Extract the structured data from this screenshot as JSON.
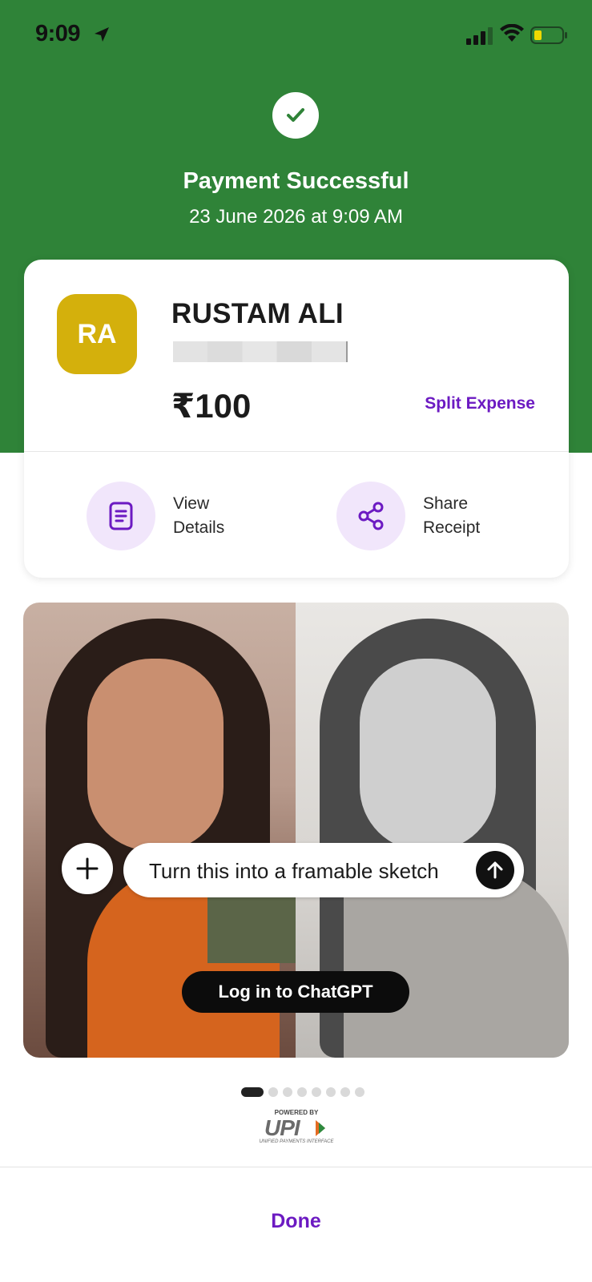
{
  "status_bar": {
    "time": "9:09"
  },
  "success": {
    "title": "Payment Successful",
    "date": "23 June 2026 at 9:09 AM"
  },
  "payee": {
    "initials": "RA",
    "name": "RUSTAM ALI",
    "amount": "₹100",
    "split_label": "Split Expense"
  },
  "actions": {
    "view_details": "View Details",
    "share_receipt": "Share Receipt"
  },
  "banner": {
    "prompt": "Turn this into a framable sketch",
    "login_label": "Log in to ChatGPT"
  },
  "upi": {
    "powered": "POWERED BY",
    "name": "UPI",
    "sub": "UNIFIED PAYMENTS INTERFACE"
  },
  "footer": {
    "done_label": "Done"
  },
  "colors": {
    "brand_green": "#2f8338",
    "accent_purple": "#6c1ac2",
    "avatar_yellow": "#d4b00c"
  }
}
